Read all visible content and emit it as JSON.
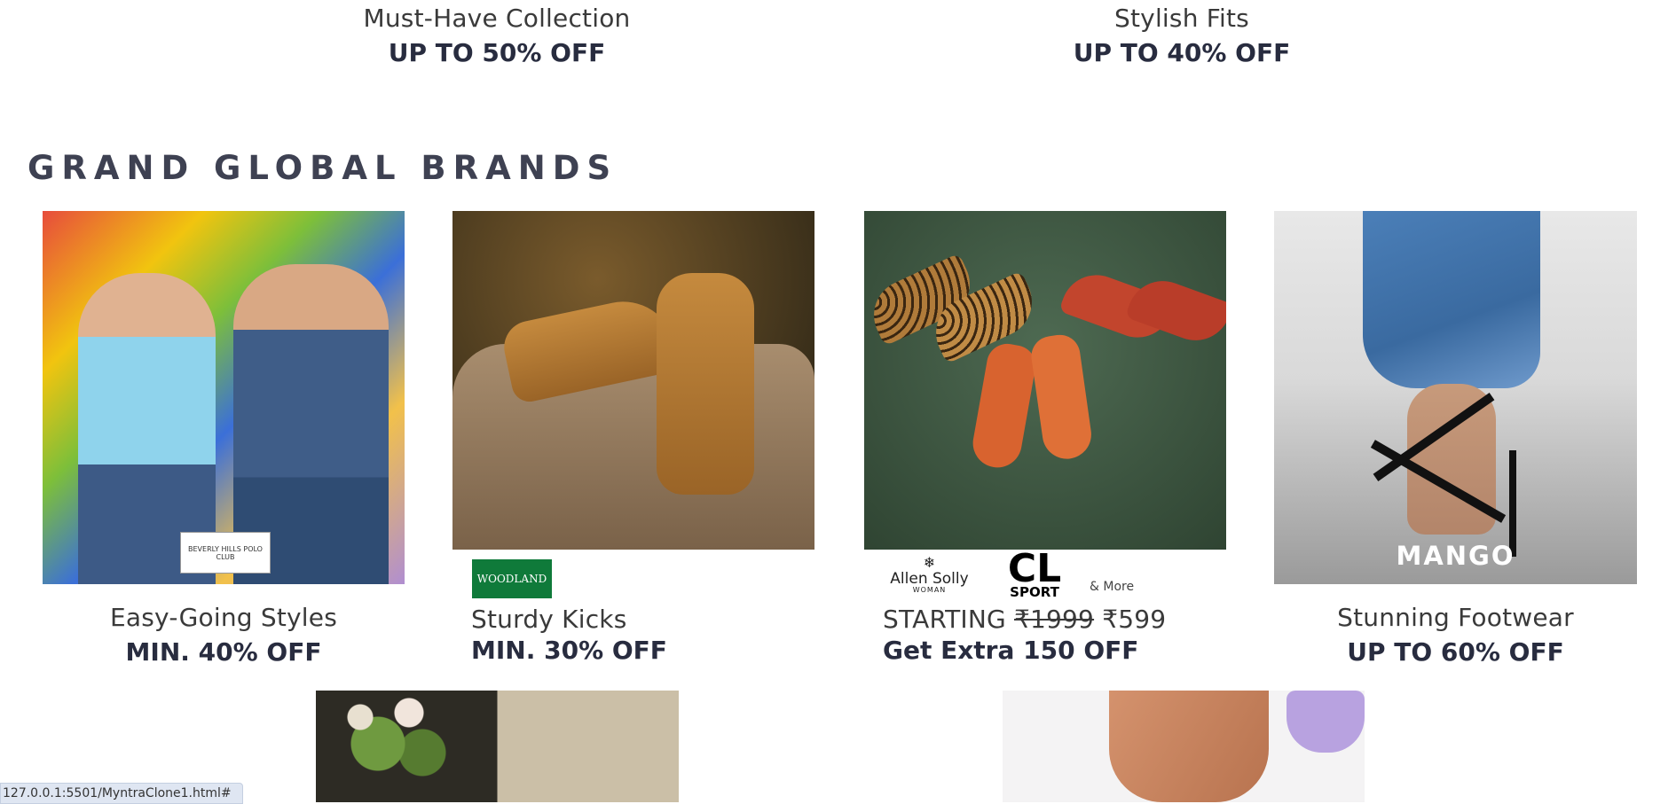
{
  "top_banners": [
    {
      "caption": "Must-Have Collection",
      "offer": "UP TO 50% OFF"
    },
    {
      "caption": "Stylish Fits",
      "offer": "UP TO 40% OFF"
    }
  ],
  "section": {
    "title": "GRAND GLOBAL BRANDS"
  },
  "cards": [
    {
      "caption": "Easy-Going Styles",
      "offer": "MIN. 40% OFF",
      "brand_logo": "BEVERLY HILLS POLO CLUB"
    },
    {
      "caption": "Sturdy Kicks",
      "offer": "MIN. 30% OFF",
      "brand_logo": "WOODLAND"
    },
    {
      "caption_prefix": "STARTING",
      "price_old": "₹1999",
      "price_new": "₹599",
      "offer": "Get Extra 150 OFF",
      "brand_1": "Allen Solly",
      "brand_1_sub": "WOMAN",
      "brand_2": "CL",
      "brand_2_sub": "SPORT",
      "more": "& More"
    },
    {
      "caption": "Stunning Footwear",
      "offer": "UP TO 60% OFF",
      "brand_logo": "MANGO"
    }
  ],
  "status_bar": {
    "url": "127.0.0.1:5501/MyntraClone1.html#"
  }
}
